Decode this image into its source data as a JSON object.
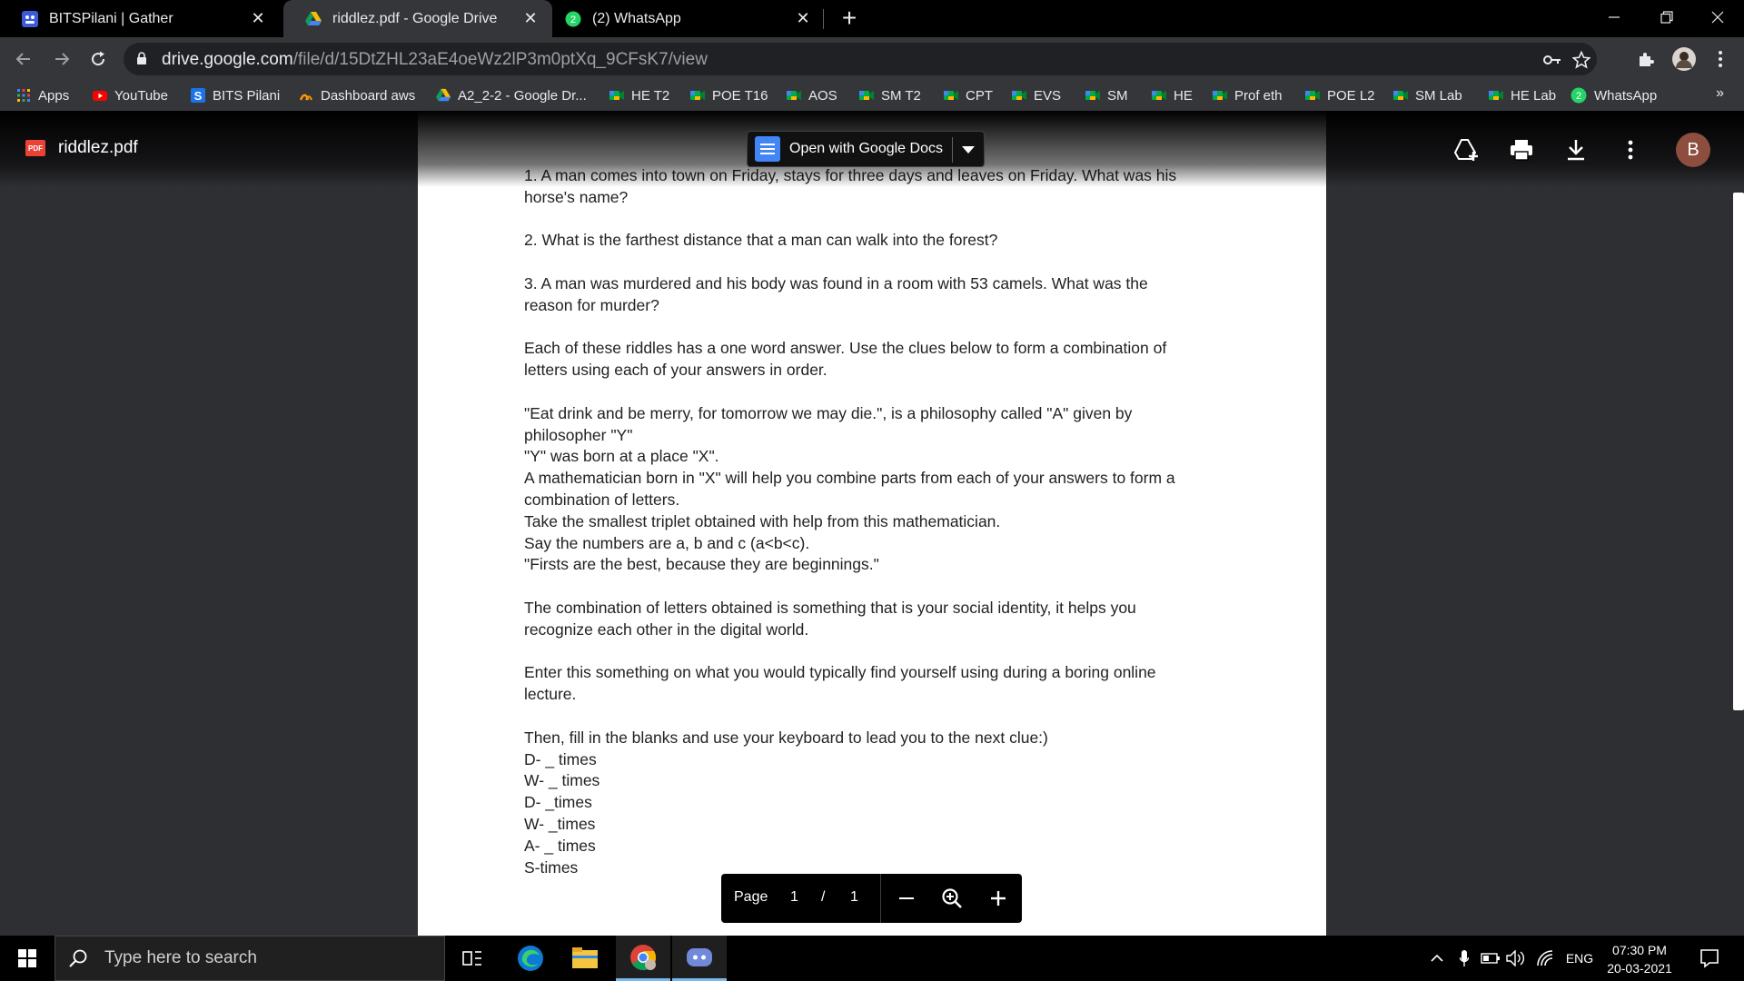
{
  "browser": {
    "tabs": [
      {
        "title": "BITSPilani | Gather",
        "icon": "gather-icon",
        "active": false
      },
      {
        "title": "riddlez.pdf - Google Drive",
        "icon": "google-drive-icon",
        "active": true
      },
      {
        "title": "(2) WhatsApp",
        "icon": "whatsapp-icon",
        "active": false
      }
    ],
    "url_host": "drive.google.com",
    "url_path": "/file/d/15DtZHL23aE4oeWz2lP3m0ptXq_9CFsK7/view"
  },
  "bookmarks": [
    {
      "label": "Apps",
      "icon": "apps-grid-icon"
    },
    {
      "label": "YouTube",
      "icon": "youtube-icon"
    },
    {
      "label": "BITS Pilani",
      "icon": "bits-icon"
    },
    {
      "label": "Dashboard aws",
      "icon": "aws-icon"
    },
    {
      "label": "A2_2-2 - Google Dr...",
      "icon": "google-drive-icon"
    },
    {
      "label": "HE T2",
      "icon": "meet-icon"
    },
    {
      "label": "POE T16",
      "icon": "meet-icon"
    },
    {
      "label": "AOS",
      "icon": "meet-icon"
    },
    {
      "label": "SM T2",
      "icon": "meet-icon"
    },
    {
      "label": "CPT",
      "icon": "meet-icon"
    },
    {
      "label": "EVS",
      "icon": "meet-icon"
    },
    {
      "label": "SM",
      "icon": "meet-icon"
    },
    {
      "label": "HE",
      "icon": "meet-icon"
    },
    {
      "label": "Prof eth",
      "icon": "meet-icon"
    },
    {
      "label": "POE L2",
      "icon": "meet-icon"
    },
    {
      "label": "SM Lab",
      "icon": "meet-icon"
    },
    {
      "label": "HE Lab",
      "icon": "meet-icon"
    },
    {
      "label": "WhatsApp",
      "icon": "whatsapp-icon"
    }
  ],
  "viewer": {
    "file_name": "riddlez.pdf",
    "file_badge": "PDF",
    "open_with_label": "Open with Google Docs",
    "avatar_initial": "B",
    "page_label": "Page",
    "page_current": "1",
    "page_separator": "/",
    "page_total": "1"
  },
  "document": {
    "paragraphs": [
      [
        "1. A man comes into town on Friday, stays for three  days and leaves on Friday. What was his",
        "horse's name?"
      ],
      [
        "2. What is the farthest distance that a man can walk into the forest?"
      ],
      [
        "3. A man was murdered and his body was found in a  room with 53 camels. What was the",
        "reason for murder?"
      ],
      [
        "Each of these riddles has a one word answer. Use the clues below to form a combination of",
        "letters using each of your answers in order."
      ],
      [
        "\"Eat drink and be merry, for tomorrow we may die.\", is a philosophy called \"A\" given by",
        "philosopher \"Y\"",
        "\"Y\" was born at a place \"X\".",
        "A mathematician born in \"X\" will help you combine parts from each of your answers to form a",
        "combination of letters.",
        "Take the smallest triplet obtained with help from this mathematician.",
        "Say the numbers are a, b and c (a<b<c).",
        "\"Firsts are the best, because they are beginnings.\""
      ],
      [
        "The combination of letters obtained is something that is your social identity, it helps you",
        "recognize each other in the digital world."
      ],
      [
        "Enter this something on what you would typically find yourself using during a boring online",
        "lecture."
      ],
      [
        "Then, fill in the blanks and use your keyboard to lead you to the next clue:)",
        "D- _ times",
        "W- _ times",
        "D- _times",
        "W- _times",
        "A- _ times",
        "S-times"
      ]
    ]
  },
  "taskbar": {
    "search_placeholder": "Type here to search",
    "language": "ENG",
    "time": "07:30 PM",
    "date": "20-03-2021"
  }
}
